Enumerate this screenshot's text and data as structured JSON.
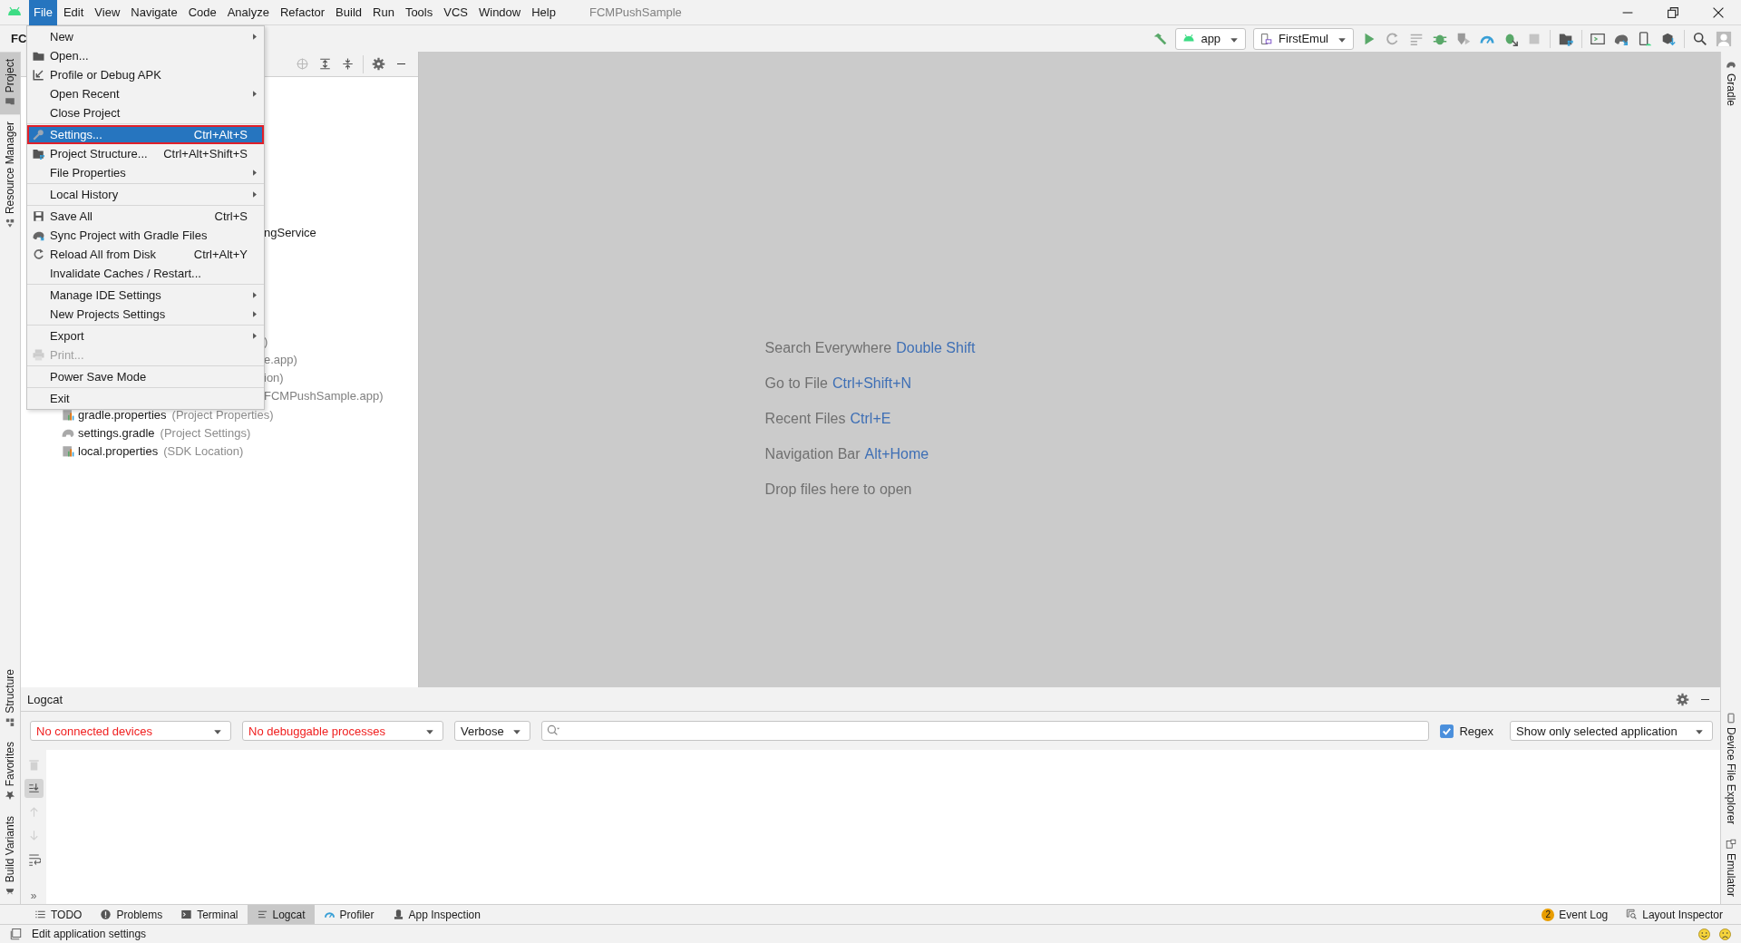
{
  "menu_bar": {
    "items": [
      {
        "label": "File",
        "selected": true
      },
      {
        "label": "Edit",
        "selected": false
      },
      {
        "label": "View",
        "selected": false
      },
      {
        "label": "Navigate",
        "selected": false
      },
      {
        "label": "Code",
        "selected": false
      },
      {
        "label": "Analyze",
        "selected": false
      },
      {
        "label": "Refactor",
        "selected": false
      },
      {
        "label": "Build",
        "selected": false
      },
      {
        "label": "Run",
        "selected": false
      },
      {
        "label": "Tools",
        "selected": false
      },
      {
        "label": "VCS",
        "selected": false
      },
      {
        "label": "Window",
        "selected": false
      },
      {
        "label": "Help",
        "selected": false
      }
    ],
    "project_title": "FCMPushSample"
  },
  "toolbar": {
    "breadcrumb": "FC",
    "run_config": "app",
    "device": "FirstEmul"
  },
  "file_menu": {
    "groups": [
      [
        {
          "label": "New",
          "submenu": true,
          "selected": false,
          "disabled": false
        },
        {
          "label": "Open...",
          "submenu": false,
          "selected": false,
          "disabled": false
        },
        {
          "label": "Profile or Debug APK",
          "submenu": false,
          "selected": false,
          "disabled": false
        },
        {
          "label": "Open Recent",
          "submenu": true,
          "selected": false,
          "disabled": false
        },
        {
          "label": "Close Project",
          "submenu": false,
          "selected": false,
          "disabled": false
        }
      ],
      [
        {
          "label": "Settings...",
          "shortcut": "Ctrl+Alt+S",
          "submenu": false,
          "selected": true,
          "disabled": false
        },
        {
          "label": "Project Structure...",
          "shortcut": "Ctrl+Alt+Shift+S",
          "submenu": false,
          "selected": false,
          "disabled": false
        },
        {
          "label": "File Properties",
          "submenu": true,
          "selected": false,
          "disabled": false
        }
      ],
      [
        {
          "label": "Local History",
          "submenu": true,
          "selected": false,
          "disabled": false
        }
      ],
      [
        {
          "label": "Save All",
          "shortcut": "Ctrl+S",
          "submenu": false,
          "selected": false,
          "disabled": false
        },
        {
          "label": "Sync Project with Gradle Files",
          "submenu": false,
          "selected": false,
          "disabled": false
        },
        {
          "label": "Reload All from Disk",
          "shortcut": "Ctrl+Alt+Y",
          "submenu": false,
          "selected": false,
          "disabled": false
        },
        {
          "label": "Invalidate Caches / Restart...",
          "submenu": false,
          "selected": false,
          "disabled": false
        }
      ],
      [
        {
          "label": "Manage IDE Settings",
          "submenu": true,
          "selected": false,
          "disabled": false
        },
        {
          "label": "New Projects Settings",
          "submenu": true,
          "selected": false,
          "disabled": false
        }
      ],
      [
        {
          "label": "Export",
          "submenu": true,
          "selected": false,
          "disabled": false
        },
        {
          "label": "Print...",
          "submenu": false,
          "selected": false,
          "disabled": true
        }
      ],
      [
        {
          "label": "Power Save Mode",
          "submenu": false,
          "selected": false,
          "disabled": false
        }
      ],
      [
        {
          "label": "Exit",
          "submenu": false,
          "selected": false,
          "disabled": false
        }
      ]
    ]
  },
  "left_stripe": {
    "top": [
      {
        "label": "Project",
        "selected": true
      },
      {
        "label": "Resource Manager",
        "selected": false
      }
    ],
    "bottom": [
      {
        "label": "Structure",
        "selected": false
      },
      {
        "label": "Favorites",
        "selected": false
      },
      {
        "label": "Build Variants",
        "selected": false
      }
    ]
  },
  "right_stripe": {
    "top": [
      {
        "label": "Gradle"
      }
    ],
    "bottom": [
      {
        "label": "Device File Explorer"
      },
      {
        "label": "Emulator"
      }
    ]
  },
  "project_tree": {
    "fragments": [
      {
        "text": "ngService",
        "kind": "name"
      },
      {
        "text": ")",
        "kind": "note"
      },
      {
        "text": "e.app)",
        "kind": "note"
      },
      {
        "text": "ion)",
        "kind": "note"
      },
      {
        "text": "FCMPushSample.app)",
        "kind": "note"
      }
    ],
    "items": [
      {
        "name": "gradle.properties",
        "note": "(Project Properties)"
      },
      {
        "name": "settings.gradle",
        "note": "(Project Settings)"
      },
      {
        "name": "local.properties",
        "note": "(SDK Location)"
      }
    ]
  },
  "editor_hints": [
    {
      "text": "Search Everywhere",
      "shortcut": "Double Shift"
    },
    {
      "text": "Go to File",
      "shortcut": "Ctrl+Shift+N"
    },
    {
      "text": "Recent Files",
      "shortcut": "Ctrl+E"
    },
    {
      "text": "Navigation Bar",
      "shortcut": "Alt+Home"
    },
    {
      "text": "Drop files here to open"
    }
  ],
  "logcat": {
    "title": "Logcat",
    "device": "No connected devices",
    "process": "No debuggable processes",
    "log_level": "Verbose",
    "regex": {
      "label": "Regex",
      "checked": true
    },
    "filter": "Show only selected application",
    "tools": [
      {
        "selected": false,
        "disabled": true
      },
      {
        "selected": true,
        "disabled": false
      },
      {
        "selected": false,
        "disabled": true
      },
      {
        "selected": false,
        "disabled": true
      },
      {
        "selected": false,
        "disabled": false
      }
    ],
    "more": "»"
  },
  "tool_tabs": {
    "left": [
      {
        "label": "TODO",
        "selected": false
      },
      {
        "label": "Problems",
        "selected": false
      },
      {
        "label": "Terminal",
        "selected": false
      },
      {
        "label": "Logcat",
        "selected": true
      },
      {
        "label": "Profiler",
        "selected": false
      },
      {
        "label": "App Inspection",
        "selected": false
      }
    ],
    "right": [
      {
        "label": "Event Log",
        "badge": "2"
      },
      {
        "label": "Layout Inspector"
      }
    ]
  },
  "status_bar": {
    "message": "Edit application settings"
  }
}
